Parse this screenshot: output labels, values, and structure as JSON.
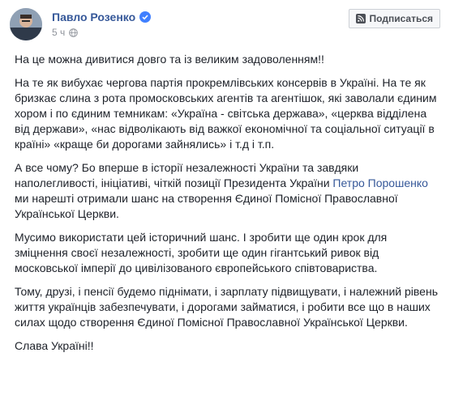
{
  "post": {
    "author": "Павло Розенко",
    "time": "5 ч",
    "subscribe_label": "Подписаться",
    "paragraphs": {
      "p1": "На це можна дивитися довго та із великим задоволенням!!",
      "p2": "На те як вибухає чергова партія прокремлівських консервів в Україні. На те як бризкає слина з рота промосковських агентів та агентішок, які заволали єдиним хором і по єдиним темникам: «Україна - світська держава», «церква відділена від держави», «нас відволікають від важкої економічної та соціальної ситуації в країні» «краще би дорогами зайнялись» і т.д і т.п.",
      "p3_before": "А все чому? Бо вперше в історії незалежності України та завдяки наполегливості, ініціативі, чіткій позиції Президента України ",
      "p3_link": "Петро Порошенко",
      "p3_after": " ми нарешті отримали шанс на створення Єдиної Помісної Православної Української Церкви.",
      "p4": "Мусимо використати цей історичний шанс. І зробити ще один крок для зміцнення своєї незалежності, зробити ще один гігантський ривок від московської імперії до цивілізованого європейського співтовариства.",
      "p5": "Тому, друзі, і пенсії будемо піднімати, і зарплату підвищувати, і належний рівень життя українців забезпечувати, і дорогами займатися, і робити все що в наших силах щодо створення Єдиної Помісної Православної Української Церкви.",
      "p6": "Слава Україні!!"
    }
  },
  "colors": {
    "link": "#365899",
    "meta": "#90949c",
    "verified": "#4080ff"
  },
  "icons": {
    "verified": "verified-badge-icon",
    "privacy": "globe-icon",
    "subscribe": "rss-icon"
  }
}
